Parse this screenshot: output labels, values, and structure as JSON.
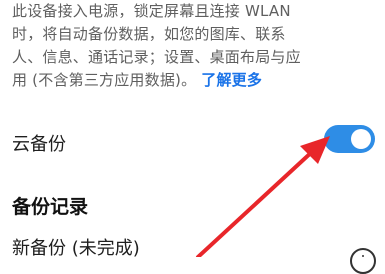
{
  "description": {
    "line1": "此设备接入电源，锁定屏幕且连接 WLAN",
    "line2": "时，将自动备份数据，如您的图库、联系",
    "line3": "人、信息、通话记录；设置、桌面布局与应",
    "line4_prefix": "用 (不含第三方应用数据)。",
    "learn_more_link": "了解更多"
  },
  "cloud_backup": {
    "label": "云备份",
    "enabled": true
  },
  "backup_records": {
    "title": "备份记录",
    "items": [
      {
        "label": "新备份 (未完成)"
      }
    ]
  },
  "colors": {
    "accent": "#2e8de6",
    "link": "#1a73e8",
    "annotation_arrow": "#e8262a"
  },
  "icons": {
    "info": "info-icon",
    "arrow": "red-annotation-arrow"
  }
}
